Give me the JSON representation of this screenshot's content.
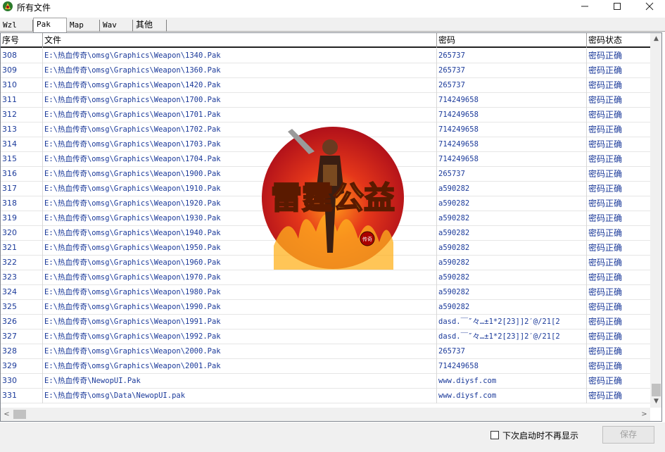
{
  "window": {
    "title": "所有文件",
    "app_icon": "game-logo-icon",
    "controls": {
      "minimize": "minimize-icon",
      "maximize": "maximize-icon",
      "close": "close-icon"
    }
  },
  "tabs": [
    {
      "label": "Wzl",
      "active": false
    },
    {
      "label": "Pak",
      "active": true
    },
    {
      "label": "Map",
      "active": false
    },
    {
      "label": "Wav",
      "active": false
    },
    {
      "label": "其他",
      "active": false
    }
  ],
  "table": {
    "columns": [
      "序号",
      "文件",
      "密码",
      "密码状态"
    ],
    "rows": [
      [
        "308",
        "E:\\热血传奇\\omsg\\Graphics\\Weapon\\1340.Pak",
        "265737",
        "密码正确"
      ],
      [
        "309",
        "E:\\热血传奇\\omsg\\Graphics\\Weapon\\1360.Pak",
        "265737",
        "密码正确"
      ],
      [
        "310",
        "E:\\热血传奇\\omsg\\Graphics\\Weapon\\1420.Pak",
        "265737",
        "密码正确"
      ],
      [
        "311",
        "E:\\热血传奇\\omsg\\Graphics\\Weapon\\1700.Pak",
        "714249658",
        "密码正确"
      ],
      [
        "312",
        "E:\\热血传奇\\omsg\\Graphics\\Weapon\\1701.Pak",
        "714249658",
        "密码正确"
      ],
      [
        "313",
        "E:\\热血传奇\\omsg\\Graphics\\Weapon\\1702.Pak",
        "714249658",
        "密码正确"
      ],
      [
        "314",
        "E:\\热血传奇\\omsg\\Graphics\\Weapon\\1703.Pak",
        "714249658",
        "密码正确"
      ],
      [
        "315",
        "E:\\热血传奇\\omsg\\Graphics\\Weapon\\1704.Pak",
        "714249658",
        "密码正确"
      ],
      [
        "316",
        "E:\\热血传奇\\omsg\\Graphics\\Weapon\\1900.Pak",
        "265737",
        "密码正确"
      ],
      [
        "317",
        "E:\\热血传奇\\omsg\\Graphics\\Weapon\\1910.Pak",
        "a590282",
        "密码正确"
      ],
      [
        "318",
        "E:\\热血传奇\\omsg\\Graphics\\Weapon\\1920.Pak",
        "a590282",
        "密码正确"
      ],
      [
        "319",
        "E:\\热血传奇\\omsg\\Graphics\\Weapon\\1930.Pak",
        "a590282",
        "密码正确"
      ],
      [
        "320",
        "E:\\热血传奇\\omsg\\Graphics\\Weapon\\1940.Pak",
        "a590282",
        "密码正确"
      ],
      [
        "321",
        "E:\\热血传奇\\omsg\\Graphics\\Weapon\\1950.Pak",
        "a590282",
        "密码正确"
      ],
      [
        "322",
        "E:\\热血传奇\\omsg\\Graphics\\Weapon\\1960.Pak",
        "a590282",
        "密码正确"
      ],
      [
        "323",
        "E:\\热血传奇\\omsg\\Graphics\\Weapon\\1970.Pak",
        "a590282",
        "密码正确"
      ],
      [
        "324",
        "E:\\热血传奇\\omsg\\Graphics\\Weapon\\1980.Pak",
        "a590282",
        "密码正确"
      ],
      [
        "325",
        "E:\\热血传奇\\omsg\\Graphics\\Weapon\\1990.Pak",
        "a590282",
        "密码正确"
      ],
      [
        "326",
        "E:\\热血传奇\\omsg\\Graphics\\Weapon\\1991.Pak",
        "dasd.￣″々…±1*2[23]]2′@/21[2",
        "密码正确"
      ],
      [
        "327",
        "E:\\热血传奇\\omsg\\Graphics\\Weapon\\1992.Pak",
        "dasd.￣″々…±1*2[23]]2′@/21[2",
        "密码正确"
      ],
      [
        "328",
        "E:\\热血传奇\\omsg\\Graphics\\Weapon\\2000.Pak",
        "265737",
        "密码正确"
      ],
      [
        "329",
        "E:\\热血传奇\\omsg\\Graphics\\Weapon\\2001.Pak",
        "714249658",
        "密码正确"
      ],
      [
        "330",
        "E:\\热血传奇\\NewopUI.Pak",
        "www.diysf.com",
        "密码正确"
      ],
      [
        "331",
        "E:\\热血传奇\\omsg\\Data\\NewopUI.pak",
        "www.diysf.com",
        "密码正确"
      ]
    ]
  },
  "logo": {
    "text": "雷霆公益",
    "seal": "传奇",
    "colors": {
      "background": "#c8141e",
      "text": "#f7e21a"
    }
  },
  "scroll": {
    "up": "▲",
    "down": "▼",
    "left": "<",
    "right": ">"
  },
  "footer": {
    "checkbox_label": "下次启动时不再显示",
    "checkbox_checked": false,
    "save_label": "保存"
  },
  "colors": {
    "row_text": "#1b3a9a",
    "disabled_button_text": "#a0a0a0"
  }
}
